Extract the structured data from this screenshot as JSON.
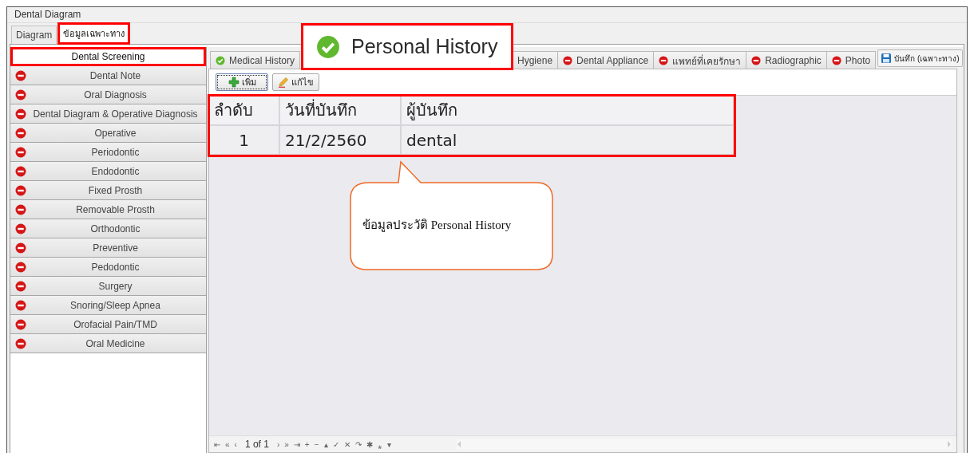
{
  "window": {
    "title": "Dental Diagram"
  },
  "main_tabs": [
    {
      "label": "Diagram",
      "selected": false,
      "highlighted": false
    },
    {
      "label": "ข้อมูลเฉพาะทาง",
      "selected": true,
      "highlighted": true
    }
  ],
  "sidebar": {
    "items": [
      {
        "label": "Dental Screening",
        "kind": "plain",
        "selected": true,
        "highlighted": true
      },
      {
        "label": "Dental Note",
        "kind": "missing",
        "selected": false,
        "highlighted": false
      },
      {
        "label": "Oral Diagnosis",
        "kind": "missing",
        "selected": false,
        "highlighted": false
      },
      {
        "label": "Dental Diagram & Operative Diagnosis",
        "kind": "missing",
        "selected": false,
        "highlighted": false
      },
      {
        "label": "Operative",
        "kind": "missing",
        "selected": false,
        "highlighted": false
      },
      {
        "label": "Periodontic",
        "kind": "missing",
        "selected": false,
        "highlighted": false
      },
      {
        "label": "Endodontic",
        "kind": "missing",
        "selected": false,
        "highlighted": false
      },
      {
        "label": "Fixed Prosth",
        "kind": "missing",
        "selected": false,
        "highlighted": false
      },
      {
        "label": "Removable Prosth",
        "kind": "missing",
        "selected": false,
        "highlighted": false
      },
      {
        "label": "Orthodontic",
        "kind": "missing",
        "selected": false,
        "highlighted": false
      },
      {
        "label": "Preventive",
        "kind": "missing",
        "selected": false,
        "highlighted": false
      },
      {
        "label": "Pedodontic",
        "kind": "missing",
        "selected": false,
        "highlighted": false
      },
      {
        "label": "Surgery",
        "kind": "missing",
        "selected": false,
        "highlighted": false
      },
      {
        "label": "Snoring/Sleep Apnea",
        "kind": "missing",
        "selected": false,
        "highlighted": false
      },
      {
        "label": "Orofacial Pain/TMD",
        "kind": "missing",
        "selected": false,
        "highlighted": false
      },
      {
        "label": "Oral Medicine",
        "kind": "missing",
        "selected": false,
        "highlighted": false
      }
    ]
  },
  "section_tabs": [
    {
      "label": "Medical History",
      "kind": "ok"
    },
    {
      "label": "Hygiene",
      "kind": "plain"
    },
    {
      "label": "Dental Appliance",
      "kind": "missing"
    },
    {
      "label": "แพทย์ที่เคยรักษา",
      "kind": "missing"
    },
    {
      "label": "Radiographic",
      "kind": "missing"
    },
    {
      "label": "Photo",
      "kind": "missing"
    }
  ],
  "save_button": {
    "label": "บันทึก (เฉพาะทาง)"
  },
  "toolbar": [
    {
      "label": "เพิ่ม",
      "kind": "add"
    },
    {
      "label": "แก้ไข",
      "kind": "edit"
    }
  ],
  "table": {
    "highlighted": true,
    "columns": [
      "ลำดับ",
      "วันที่บันทึก",
      "ผู้บันทึก"
    ],
    "rows": [
      [
        "1",
        "21/2/2560",
        "dental"
      ]
    ]
  },
  "navigator": {
    "buttons_before": [
      "⇤",
      "«",
      "‹"
    ],
    "page": "1 of 1",
    "buttons_after": [
      "›",
      "»",
      "⇥",
      "+",
      "−",
      "▴",
      "✓",
      "✕",
      "↷",
      "✱",
      "⁎",
      "▾"
    ]
  },
  "zoom_annotation": {
    "label": "Personal History",
    "kind": "ok"
  },
  "callout": {
    "text": "ข้อมูลประวัติ Personal History"
  }
}
